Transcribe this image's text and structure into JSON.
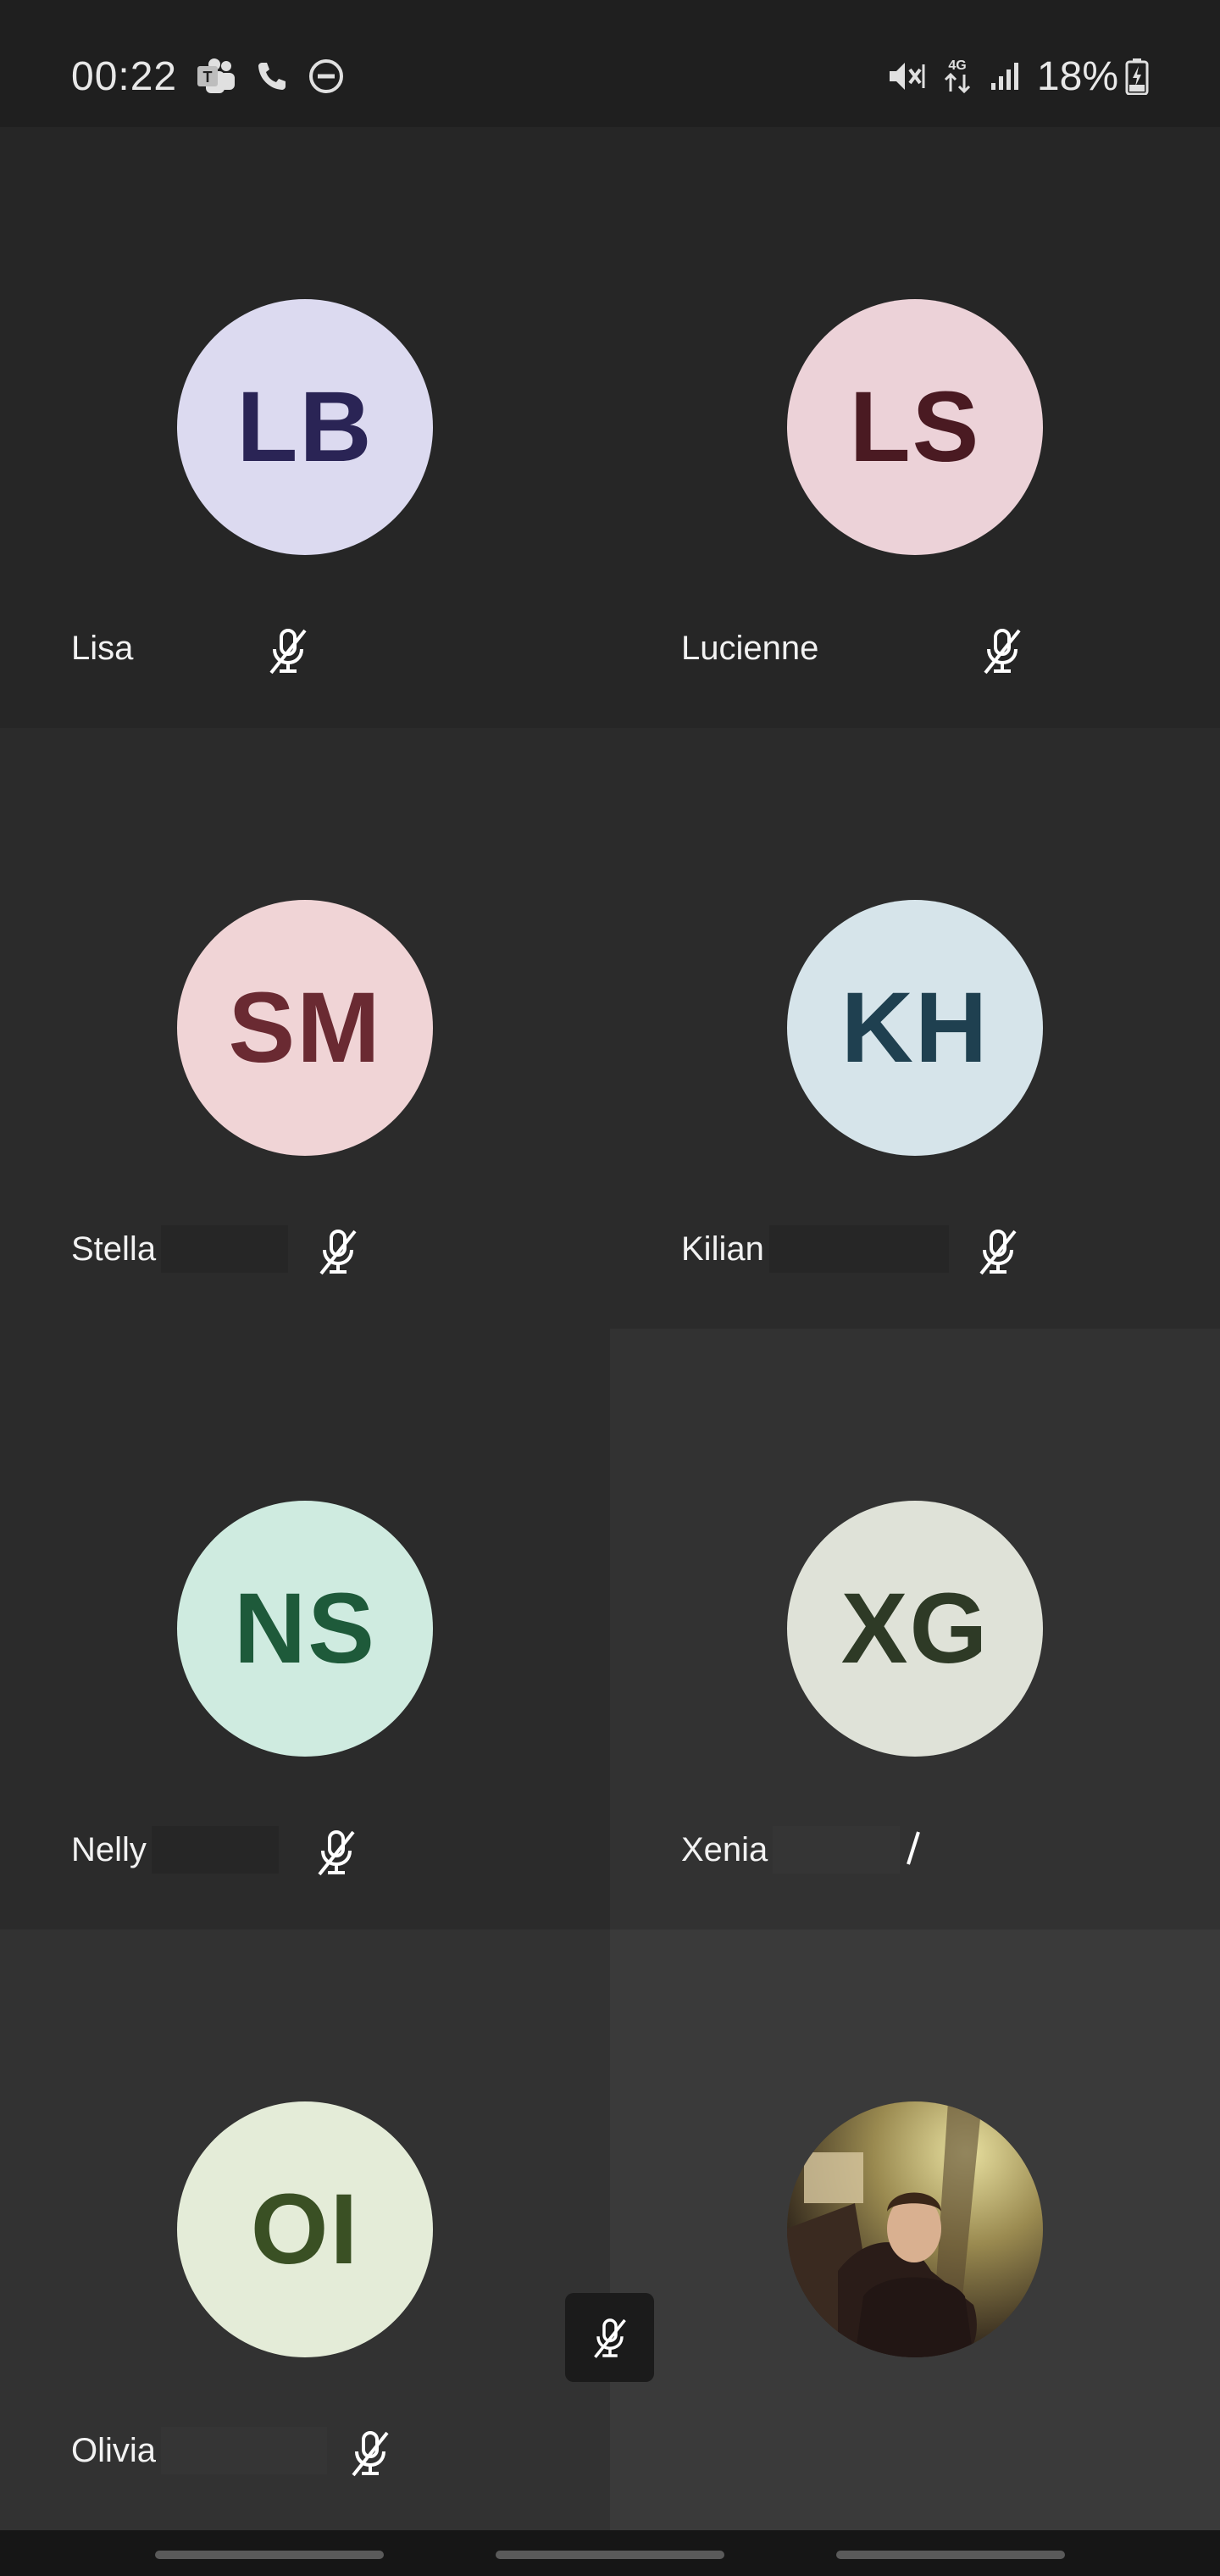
{
  "status_bar": {
    "time": "00:22",
    "battery_percent": "18%",
    "left_icons": [
      "teams-icon",
      "phone-call-icon",
      "do-not-disturb-icon"
    ],
    "right_icons": [
      "vibrate-mute-icon",
      "4g-data-icon",
      "signal-bars-icon",
      "battery-charging-icon"
    ]
  },
  "participants": [
    {
      "initials": "LB",
      "name": "Lisa",
      "avatar_bg": "#dcdaf0",
      "initials_color": "#2a2455",
      "muted": true
    },
    {
      "initials": "LS",
      "name": "Lucienne",
      "avatar_bg": "#ecd2d8",
      "initials_color": "#4a1a22",
      "muted": true
    },
    {
      "initials": "SM",
      "name": "Stella",
      "avatar_bg": "#f0d4d6",
      "initials_color": "#6a2a32",
      "muted": true
    },
    {
      "initials": "KH",
      "name": "Kilian",
      "avatar_bg": "#d6e4ea",
      "initials_color": "#1f4050",
      "muted": true
    },
    {
      "initials": "NS",
      "name": "Nelly",
      "avatar_bg": "#cfebe0",
      "initials_color": "#1e5a3a",
      "muted": true
    },
    {
      "initials": "XG",
      "name": "Xenia",
      "avatar_bg": "#dfe2d8",
      "initials_color": "#2e3a26",
      "muted": true
    },
    {
      "initials": "OI",
      "name": "Olivia",
      "avatar_bg": "#e4ecd8",
      "initials_color": "#3a5024",
      "muted": true
    },
    {
      "initials": "",
      "name": "",
      "avatar_bg": "#6a5a40",
      "initials_color": "#ffffff",
      "muted": false,
      "photo": true
    }
  ],
  "colors": {
    "tile_dark": "#262626",
    "tile_mid": "#2b2b2b",
    "tile_light": "#323232",
    "text": "#f2f2f2",
    "icon": "#ffffff"
  }
}
